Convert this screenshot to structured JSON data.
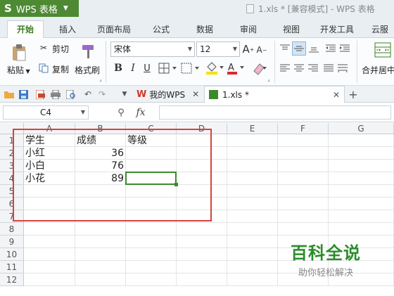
{
  "app": {
    "brand": "WPS 表格",
    "logo": "S",
    "doc_title": "1.xls * [兼容模式] - WPS 表格"
  },
  "menu": {
    "tabs": [
      "开始",
      "插入",
      "页面布局",
      "公式",
      "数据",
      "审阅",
      "视图",
      "开发工具",
      "云服务"
    ]
  },
  "ribbon": {
    "paste": "粘贴",
    "cut": "剪切",
    "copy": "复制",
    "format_painter": "格式刷",
    "font_name": "宋体",
    "font_size": "12",
    "merge_center": "合并居中"
  },
  "doc_tabs": [
    {
      "label": "我的WPS"
    },
    {
      "label": "1.xls *"
    }
  ],
  "formula_bar": {
    "cell_ref": "C4",
    "fx": "fx",
    "value": ""
  },
  "columns": [
    "A",
    "B",
    "C",
    "D",
    "E",
    "F",
    "G"
  ],
  "rows": [
    "1",
    "2",
    "3",
    "4",
    "5",
    "6",
    "7",
    "8",
    "9",
    "10",
    "11",
    "12"
  ],
  "cells": {
    "A1": "学生",
    "B1": "成绩",
    "C1": "等级",
    "A2": "小红",
    "B2": "36",
    "A3": "小白",
    "B3": "76",
    "A4": "小花",
    "B4": "89"
  },
  "selected_cell": "C4",
  "watermark": {
    "title": "百科全说",
    "subtitle": "助你轻松解决"
  },
  "colors": {
    "brand_green": "#4d8a33",
    "selection": "#3b8a2a",
    "annotation_box": "#d6433e"
  }
}
